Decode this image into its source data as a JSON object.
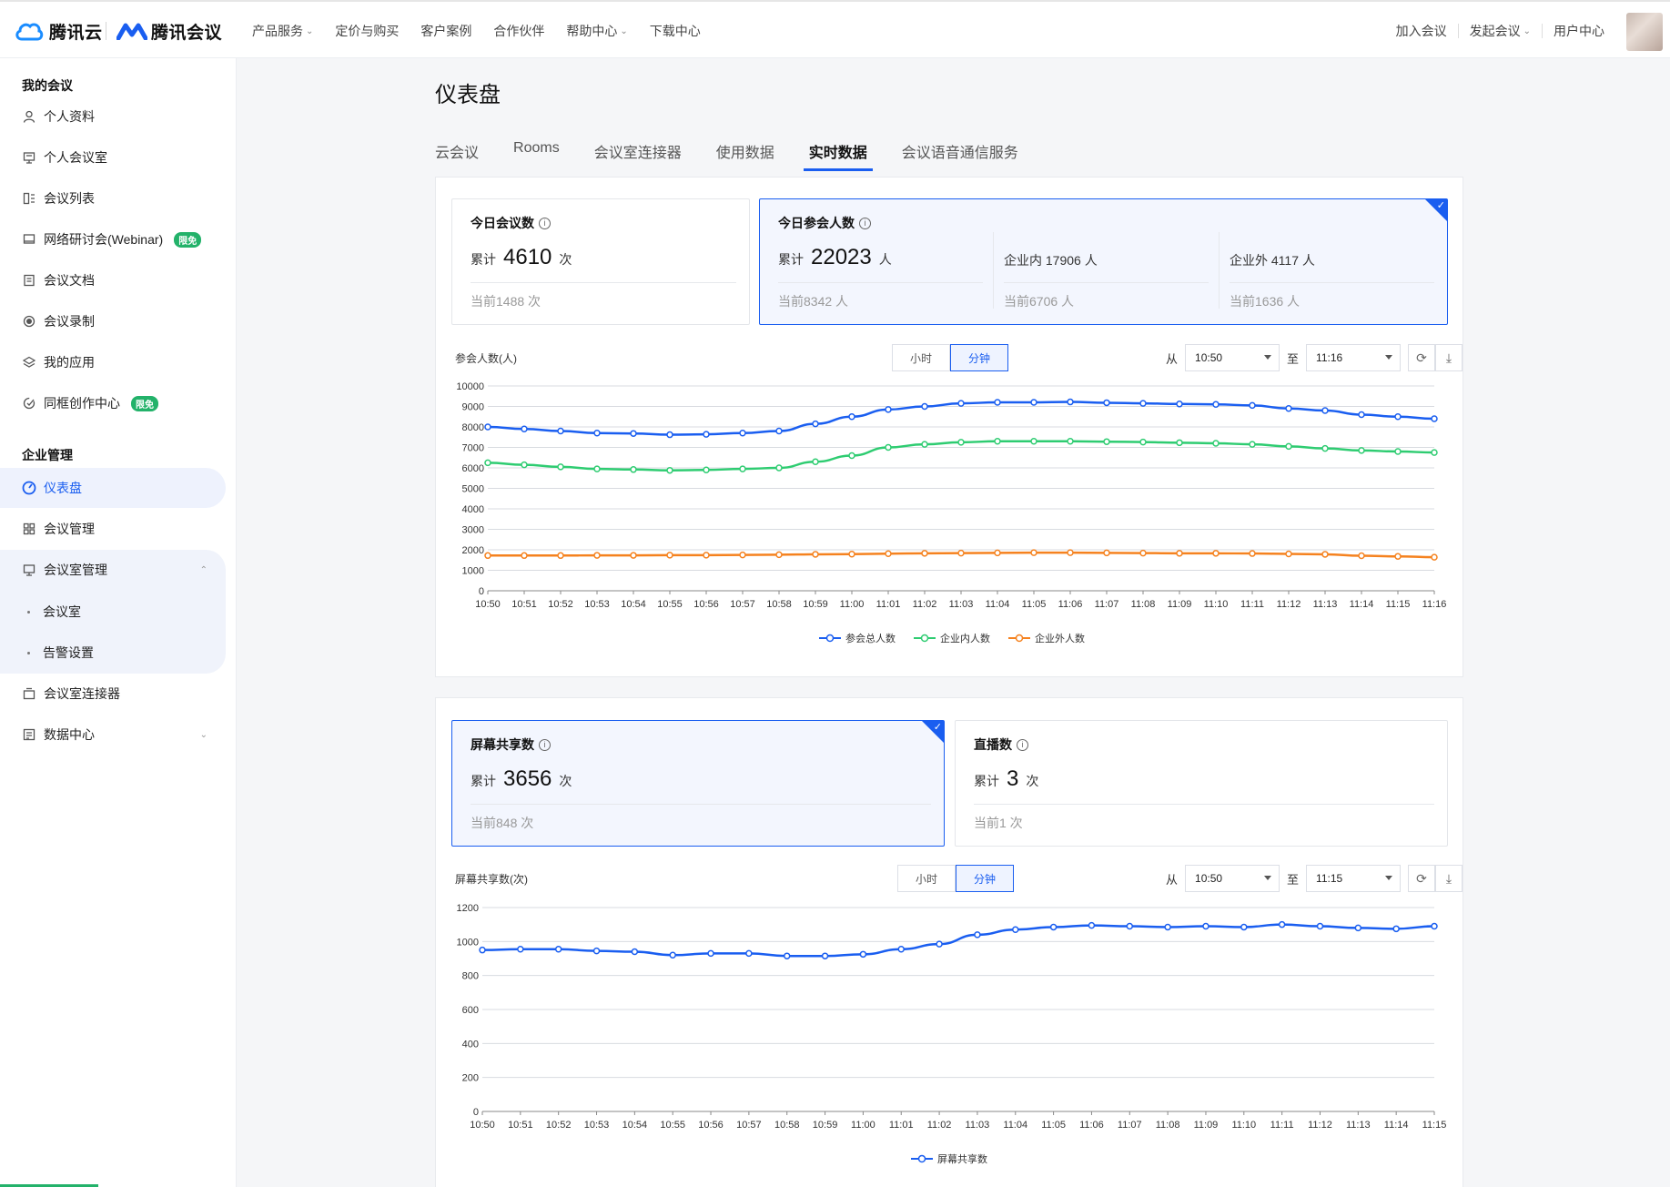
{
  "topbar": {
    "logo1": "腾讯云",
    "logo2": "腾讯会议",
    "nav": [
      {
        "label": "产品服务",
        "dropdown": true
      },
      {
        "label": "定价与购买",
        "dropdown": false
      },
      {
        "label": "客户案例",
        "dropdown": false
      },
      {
        "label": "合作伙伴",
        "dropdown": false
      },
      {
        "label": "帮助中心",
        "dropdown": true
      },
      {
        "label": "下载中心",
        "dropdown": false
      }
    ],
    "right": {
      "join": "加入会议",
      "start": "发起会议",
      "user_center": "用户中心"
    }
  },
  "sidebar": {
    "my_section": "我的会议",
    "my_items": [
      {
        "label": "个人资料",
        "icon": "user-icon"
      },
      {
        "label": "个人会议室",
        "icon": "room-icon"
      },
      {
        "label": "会议列表",
        "icon": "list-icon"
      },
      {
        "label": "网络研讨会(Webinar)",
        "icon": "monitor-icon",
        "badge": "限免"
      },
      {
        "label": "会议文档",
        "icon": "document-icon"
      },
      {
        "label": "会议录制",
        "icon": "record-icon"
      },
      {
        "label": "我的应用",
        "icon": "layers-icon"
      },
      {
        "label": "同框创作中心",
        "icon": "create-icon",
        "badge": "限免"
      }
    ],
    "ent_section": "企业管理",
    "ent_items": [
      {
        "label": "仪表盘",
        "icon": "dashboard-icon",
        "active": true
      },
      {
        "label": "会议管理",
        "icon": "grid-icon"
      },
      {
        "label": "会议室管理",
        "icon": "room-icon",
        "expanded": true
      }
    ],
    "sub_items": [
      "会议室",
      "告警设置"
    ],
    "more_items": [
      {
        "label": "会议室连接器",
        "icon": "connector-icon"
      },
      {
        "label": "数据中心",
        "icon": "data-icon"
      }
    ]
  },
  "page": {
    "title": "仪表盘",
    "tabs": [
      "云会议",
      "Rooms",
      "会议室连接器",
      "使用数据",
      "实时数据",
      "会议语音通信服务"
    ],
    "active_tab": "实时数据"
  },
  "cards1": {
    "meetings": {
      "title": "今日会议数",
      "prefix": "累计",
      "value": "4610",
      "unit": "次",
      "current": "当前1488 次"
    },
    "participants": {
      "title": "今日参会人数",
      "prefix": "累计",
      "value": "22023",
      "unit": "人",
      "current": "当前8342 人",
      "inside": "企业内 17906 人",
      "inside_current": "当前6706 人",
      "outside": "企业外 4117 人",
      "outside_current": "当前1636 人"
    }
  },
  "chart1_ui": {
    "label": "参会人数(人)",
    "toggle": [
      "小时",
      "分钟"
    ],
    "active_toggle": "分钟",
    "from_label": "从",
    "from": "10:50",
    "to_label": "至",
    "to": "11:16"
  },
  "cards2": {
    "share": {
      "title": "屏幕共享数",
      "prefix": "累计",
      "value": "3656",
      "unit": "次",
      "current": "当前848 次"
    },
    "live": {
      "title": "直播数",
      "prefix": "累计",
      "value": "3",
      "unit": "次",
      "current": "当前1 次"
    }
  },
  "chart2_ui": {
    "label": "屏幕共享数(次)",
    "toggle": [
      "小时",
      "分钟"
    ],
    "active_toggle": "分钟",
    "from_label": "从",
    "from": "10:50",
    "to_label": "至",
    "to": "11:15"
  },
  "colors": {
    "accent": "#1a5ef0",
    "green": "#2ecc71",
    "orange": "#f5821f",
    "badge": "#23b26a"
  },
  "chart_data": [
    {
      "type": "line",
      "ylabel": "参会人数(人)",
      "ylim": [
        0,
        10000
      ],
      "yticks": [
        0,
        1000,
        2000,
        3000,
        4000,
        5000,
        6000,
        7000,
        8000,
        9000,
        10000
      ],
      "x": [
        "10:50",
        "10:51",
        "10:52",
        "10:53",
        "10:54",
        "10:55",
        "10:56",
        "10:57",
        "10:58",
        "10:59",
        "11:00",
        "11:01",
        "11:02",
        "11:03",
        "11:04",
        "11:05",
        "11:06",
        "11:07",
        "11:08",
        "11:09",
        "11:10",
        "11:11",
        "11:12",
        "11:13",
        "11:14",
        "11:15",
        "11:16"
      ],
      "series": [
        {
          "name": "参会总人数",
          "color": "#1a5ef0",
          "values": [
            8000,
            7900,
            7800,
            7700,
            7680,
            7620,
            7640,
            7700,
            7800,
            8150,
            8500,
            8850,
            9000,
            9150,
            9200,
            9200,
            9220,
            9180,
            9150,
            9120,
            9100,
            9050,
            8900,
            8800,
            8600,
            8500,
            8400
          ]
        },
        {
          "name": "企业内人数",
          "color": "#2ecc71",
          "values": [
            6250,
            6150,
            6050,
            5950,
            5920,
            5880,
            5900,
            5950,
            6000,
            6300,
            6600,
            7000,
            7150,
            7250,
            7300,
            7300,
            7300,
            7280,
            7260,
            7230,
            7200,
            7150,
            7050,
            6950,
            6850,
            6800,
            6750
          ]
        },
        {
          "name": "企业外人数",
          "color": "#f5821f",
          "values": [
            1720,
            1720,
            1720,
            1730,
            1730,
            1740,
            1740,
            1750,
            1760,
            1780,
            1790,
            1810,
            1830,
            1840,
            1850,
            1860,
            1860,
            1850,
            1840,
            1830,
            1830,
            1820,
            1800,
            1780,
            1710,
            1680,
            1640
          ]
        }
      ],
      "legend": "bottom"
    },
    {
      "type": "line",
      "ylabel": "屏幕共享数(次)",
      "ylim": [
        0,
        1200
      ],
      "yticks": [
        0,
        200,
        400,
        600,
        800,
        1000,
        1200
      ],
      "x": [
        "10:50",
        "10:51",
        "10:52",
        "10:53",
        "10:54",
        "10:55",
        "10:56",
        "10:57",
        "10:58",
        "10:59",
        "11:00",
        "11:01",
        "11:02",
        "11:03",
        "11:04",
        "11:05",
        "11:06",
        "11:07",
        "11:08",
        "11:09",
        "11:10",
        "11:11",
        "11:12",
        "11:13",
        "11:14",
        "11:15"
      ],
      "series": [
        {
          "name": "屏幕共享数",
          "color": "#1a5ef0",
          "values": [
            950,
            955,
            955,
            945,
            940,
            920,
            930,
            930,
            915,
            915,
            925,
            955,
            985,
            1040,
            1070,
            1085,
            1095,
            1090,
            1085,
            1090,
            1085,
            1100,
            1090,
            1080,
            1075,
            1090
          ]
        }
      ],
      "legend": "bottom"
    }
  ]
}
